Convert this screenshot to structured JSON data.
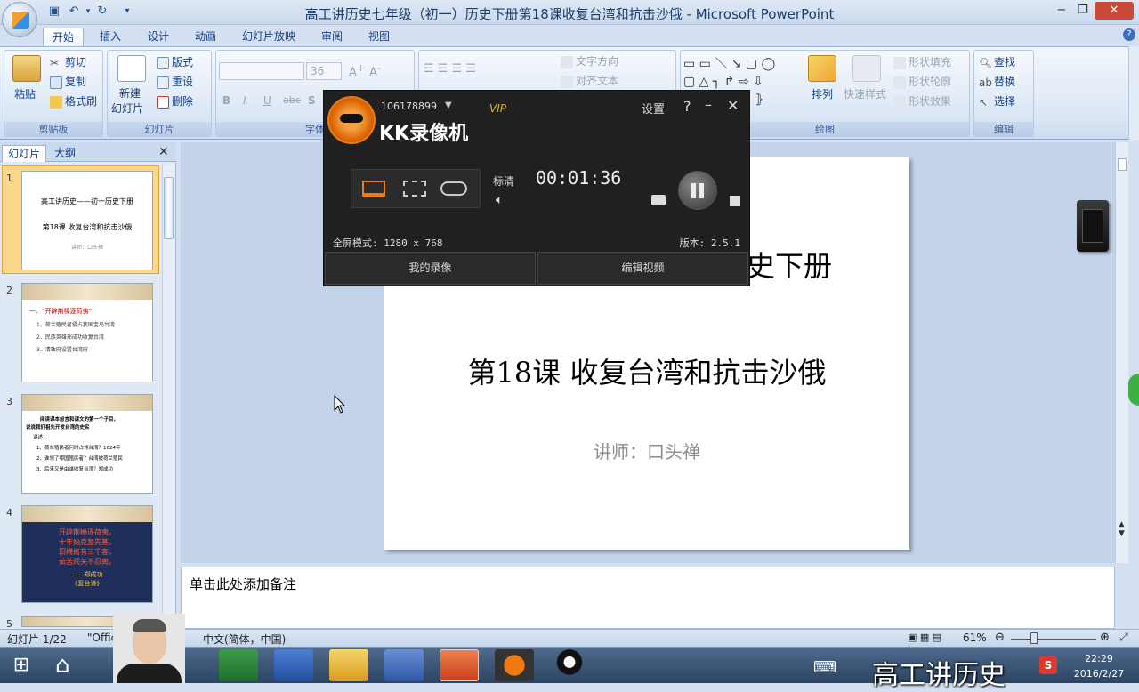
{
  "window": {
    "title": "高工讲历史七年级（初一）历史下册第18课收复台湾和抗击沙俄 - Microsoft PowerPoint"
  },
  "tabs": [
    "开始",
    "插入",
    "设计",
    "动画",
    "幻灯片放映",
    "审阅",
    "视图"
  ],
  "ribbon": {
    "clipboard": {
      "label": "剪贴板",
      "paste": "粘贴",
      "cut": "剪切",
      "copy": "复制",
      "format_painter": "格式刷"
    },
    "slides": {
      "label": "幻灯片",
      "new_slide": "新建",
      "new_slide2": "幻灯片",
      "layout": "版式",
      "reset": "重设",
      "delete": "删除"
    },
    "font": {
      "label": "字体",
      "size": "36",
      "bold": "B",
      "italic": "I",
      "underline": "U",
      "strike": "abc",
      "shadow": "S"
    },
    "paragraph": {
      "text_direction": "文字方向",
      "align_text": "对齐文本"
    },
    "drawing": {
      "label": "绘图",
      "arrange": "排列",
      "quick_styles": "快速样式",
      "fill": "形状填充",
      "outline": "形状轮廓",
      "effects": "形状效果"
    },
    "editing": {
      "label": "编辑",
      "find": "查找",
      "replace": "替换",
      "select": "选择"
    }
  },
  "panel": {
    "tab_slides": "幻灯片",
    "tab_outline": "大纲",
    "thumbs": [
      {
        "num": "1",
        "lines": [
          "高工讲历史——初一历史下册",
          "第18课 收复台湾和抗击沙俄",
          "讲师：口头禅"
        ]
      },
      {
        "num": "2",
        "heading": "一、“开辟荆榛逐荷夷”",
        "lines": [
          "1、荷兰殖民者侵占我国宝岛台湾",
          "2、民族英雄郑成功收复台湾",
          "3、清政府设置台湾府"
        ]
      },
      {
        "num": "3",
        "lines": [
          "阅读课本前言和课文的第一个子目，",
          "说说我们祖先开发台湾的史实",
          "讲述：",
          "1、荷兰殖民者何时占领台湾？1624年",
          "2、谁领了哪国殖民者？台湾被荷兰殖民",
          "3、后来又是由谁收复台湾？郑成功"
        ]
      },
      {
        "num": "4",
        "lines": [
          "开辟荆榛逐荷夷，",
          "十年始克复先基。",
          "田横尚有三千客，",
          "茹苦间关不忍离。",
          "——郑成功",
          "《复台诗》"
        ]
      },
      {
        "num": "5"
      }
    ]
  },
  "slide": {
    "title_line1": "高工讲历史——初一历史下册",
    "title_line2": "第18课 收复台湾和抗击沙俄",
    "subtitle": "讲师：口头禅"
  },
  "notes": {
    "placeholder": "单击此处添加备注"
  },
  "status": {
    "slide_count": "幻灯片 1/22",
    "theme": "\"Office",
    "language": "中文(简体，中国)",
    "zoom": "61%"
  },
  "recorder": {
    "account": "106178899",
    "vip": "VIP",
    "app_name": "KK录像机",
    "settings": "设置",
    "help": "?",
    "quality": "标清",
    "timer": "00:01:36",
    "mode": "全屏模式: 1280 x 768",
    "version": "版本: 2.5.1",
    "my_recordings": "我的录像",
    "edit_video": "编辑视频"
  },
  "taskbar": {
    "time": "22:29",
    "date": "2016/2/27",
    "watermark": "高工讲历史"
  },
  "colors": {
    "kk_orange": "#f07a10",
    "slide_title": "#000000",
    "subtitle": "#8c8c8c",
    "thumb_red": "#c00000"
  }
}
